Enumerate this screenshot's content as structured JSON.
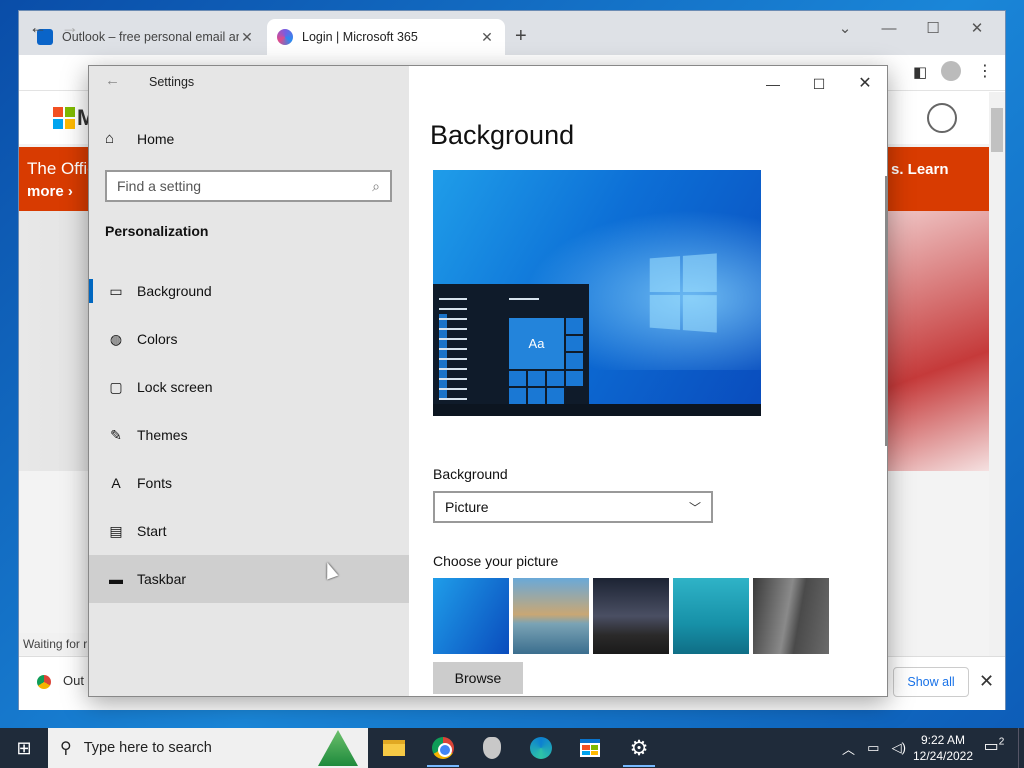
{
  "browser": {
    "tabs": [
      {
        "title": "Outlook – free personal email an",
        "active": false
      },
      {
        "title": "Login | Microsoft 365",
        "active": true
      }
    ],
    "new_tab_symbol": "+",
    "status_text": "Waiting for r",
    "page": {
      "logo_letter": "M",
      "banner_line1": "The Offic",
      "banner_line2": "more ›",
      "banner_right": "s.  Learn"
    },
    "download": {
      "item_label": "Out",
      "show_all": "Show all"
    }
  },
  "settings": {
    "window_title": "Settings",
    "home_label": "Home",
    "search_placeholder": "Find a setting",
    "section": "Personalization",
    "nav": [
      {
        "label": "Background",
        "icon": "picture-icon",
        "selected": true
      },
      {
        "label": "Colors",
        "icon": "palette-icon",
        "selected": false
      },
      {
        "label": "Lock screen",
        "icon": "lock-screen-icon",
        "selected": false
      },
      {
        "label": "Themes",
        "icon": "themes-icon",
        "selected": false
      },
      {
        "label": "Fonts",
        "icon": "fonts-icon",
        "selected": false
      },
      {
        "label": "Start",
        "icon": "start-icon",
        "selected": false
      },
      {
        "label": "Taskbar",
        "icon": "taskbar-icon",
        "selected": false,
        "hovered": true
      }
    ],
    "heading": "Background",
    "preview_tile_text": "Aa",
    "background_label": "Background",
    "background_value": "Picture",
    "choose_label": "Choose your picture",
    "browse_label": "Browse",
    "accent_color": "#0067c0"
  },
  "taskbar": {
    "search_text": "Type here to search",
    "time": "9:22 AM",
    "date": "12/24/2022",
    "notification_count": "2",
    "apps": [
      "file-explorer-icon",
      "chrome-icon",
      "shield-app-icon",
      "edge-icon",
      "store-icon",
      "settings-gear-icon"
    ]
  }
}
